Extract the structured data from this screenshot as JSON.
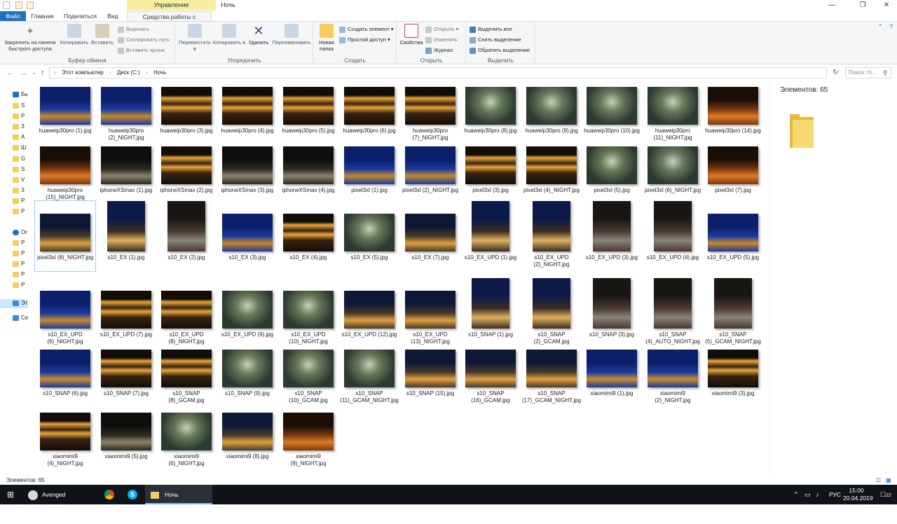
{
  "window": {
    "title": "Ночь",
    "context_tab": "Управление",
    "controls": {
      "minimize": "—",
      "maximize": "❐",
      "close": "✕"
    }
  },
  "tabs": [
    "Файл",
    "Главная",
    "Поделиться",
    "Вид",
    "Средства работы с рисунками"
  ],
  "ribbon": {
    "clipboard": {
      "label": "Буфер обмена",
      "pin": "Закрепить на панели быстрого доступа",
      "copy": "Копировать",
      "paste": "Вставить",
      "cut": "Вырезать",
      "copy_path": "Скопировать путь",
      "paste_shortcut": "Вставить ярлык"
    },
    "organize": {
      "label": "Упорядочить",
      "move": "Переместить в",
      "copyto": "Копировать в",
      "delete": "Удалить",
      "rename": "Переименовать"
    },
    "create": {
      "label": "Создать",
      "new_folder": "Новая папка",
      "new_item": "Создать элемент",
      "easy_access": "Простой доступ"
    },
    "open": {
      "label": "Открыть",
      "properties": "Свойства",
      "open": "Открыть",
      "edit": "Изменить",
      "history": "Журнал"
    },
    "select": {
      "label": "Выделить",
      "select_all": "Выделить все",
      "select_none": "Снять выделение",
      "invert": "Обратить выделение"
    }
  },
  "address": {
    "crumbs": [
      "Этот компьютер",
      "Диск (C:)",
      "Ночь"
    ],
    "search_placeholder": "Поиск: Н..."
  },
  "nav_pane": [
    "Бы",
    "S",
    "Р",
    "З",
    "А",
    "Ш",
    "G",
    "S",
    "V",
    "З",
    "Р",
    "Р",
    "Or",
    "Р",
    "Р",
    "Р",
    "Р",
    "Р",
    "Эт",
    "Се"
  ],
  "files": [
    {
      "name": "huaweip30pro (1).jpg",
      "kind": "blue"
    },
    {
      "name": "huaweip30pro (2)_NIGHT.jpg",
      "kind": "blue"
    },
    {
      "name": "huaweip30pro (3).jpg",
      "kind": "bldg"
    },
    {
      "name": "huaweip30pro (4).jpg",
      "kind": "bldg"
    },
    {
      "name": "huaweip30pro (5).jpg",
      "kind": "bldg"
    },
    {
      "name": "huaweip30pro (6).jpg",
      "kind": "bldg"
    },
    {
      "name": "huaweip30pro (7)_NIGHT.jpg",
      "kind": "bldg"
    },
    {
      "name": "huaweip30pro (8).jpg",
      "kind": "tunnel"
    },
    {
      "name": "huaweip30pro (9).jpg",
      "kind": "tunnel"
    },
    {
      "name": "huaweip30pro (10).jpg",
      "kind": "tunnel"
    },
    {
      "name": "huaweip30pro (11)_NIGHT.jpg",
      "kind": "tunnel"
    },
    {
      "name": "huaweip30pro (14).jpg",
      "kind": "warm"
    },
    {
      "name": "huaweip30pro (15)_NIGHT.jpg",
      "kind": "warm"
    },
    {
      "name": "iphoneXSmax (1).jpg",
      "kind": "dark"
    },
    {
      "name": "iphoneXSmax (2).jpg",
      "kind": "bldg"
    },
    {
      "name": "iphoneXSmax (3).jpg",
      "kind": "dark"
    },
    {
      "name": "iphoneXSmax (4).jpg",
      "kind": "dark"
    },
    {
      "name": "pixel3xl (1).jpg",
      "kind": "blue"
    },
    {
      "name": "pixel3xl (2)_NIGHT.jpg",
      "kind": "blue"
    },
    {
      "name": "pixel3xl (3).jpg",
      "kind": "bldg"
    },
    {
      "name": "pixel3xl (4)_NIGHT.jpg",
      "kind": "bldg"
    },
    {
      "name": "pixel3xl (5).jpg",
      "kind": "tunnel"
    },
    {
      "name": "pixel3xl (6)_NIGHT.jpg",
      "kind": "tunnel"
    },
    {
      "name": "pixel3xl (7).jpg",
      "kind": "warm"
    },
    {
      "name": "pixel3xl (8)_NIGHT.jpg",
      "kind": "river",
      "selected": true
    },
    {
      "name": "s10_EX (1).jpg",
      "kind": "yard",
      "portrait": true
    },
    {
      "name": "s10_EX (2).jpg",
      "kind": "wall",
      "portrait": true
    },
    {
      "name": "s10_EX (3).jpg",
      "kind": "blue"
    },
    {
      "name": "s10_EX (4).jpg",
      "kind": "bldg"
    },
    {
      "name": "s10_EX (5).jpg",
      "kind": "tunnel"
    },
    {
      "name": "s10_EX (7).jpg",
      "kind": "river"
    },
    {
      "name": "s10_EX_UPD (1).jpg",
      "kind": "yard",
      "portrait": true
    },
    {
      "name": "s10_EX_UPD (2)_NIGHT.jpg",
      "kind": "yard",
      "portrait": true
    },
    {
      "name": "s10_EX_UPD (3).jpg",
      "kind": "wall",
      "portrait": true
    },
    {
      "name": "s10_EX_UPD (4).jpg",
      "kind": "wall",
      "portrait": true
    },
    {
      "name": "s10_EX_UPD (5).jpg",
      "kind": "blue"
    },
    {
      "name": "s10_EX_UPD (6)_NIGHT.jpg",
      "kind": "blue"
    },
    {
      "name": "s10_EX_UPD (7).jpg",
      "kind": "bldg"
    },
    {
      "name": "s10_EX_UPD (8)_NIGHT.jpg",
      "kind": "bldg"
    },
    {
      "name": "s10_EX_UPD (9).jpg",
      "kind": "tunnel"
    },
    {
      "name": "s10_EX_UPD (10)_NIGHT.jpg",
      "kind": "tunnel"
    },
    {
      "name": "s10_EX_UPD (12).jpg",
      "kind": "river"
    },
    {
      "name": "s10_EX_UPD (13)_NIGHT.jpg",
      "kind": "river"
    },
    {
      "name": "s10_SNAP (1).jpg",
      "kind": "yard",
      "portrait": true
    },
    {
      "name": "s10_SNAP (2)_GCAM.jpg",
      "kind": "yard",
      "portrait": true
    },
    {
      "name": "s10_SNAP (3).jpg",
      "kind": "wall",
      "portrait": true
    },
    {
      "name": "s10_SNAP (4)_AUTO_NIGHT.jpg",
      "kind": "wall",
      "portrait": true
    },
    {
      "name": "s10_SNAP (5)_GCAM_NIGHT.jpg",
      "kind": "wall",
      "portrait": true
    },
    {
      "name": "s10_SNAP (6).jpg",
      "kind": "blue"
    },
    {
      "name": "s10_SNAP (7).jpg",
      "kind": "bldg"
    },
    {
      "name": "s10_SNAP (8)_GCAM.jpg",
      "kind": "bldg"
    },
    {
      "name": "s10_SNAP (9).jpg",
      "kind": "tunnel"
    },
    {
      "name": "s10_SNAP (10)_GCAM.jpg",
      "kind": "tunnel"
    },
    {
      "name": "s10_SNAP (11)_GCAM_NIGHT.jpg",
      "kind": "tunnel"
    },
    {
      "name": "s10_SNAP (15).jpg",
      "kind": "river"
    },
    {
      "name": "s10_SNAP (16)_GCAM.jpg",
      "kind": "river"
    },
    {
      "name": "s10_SNAP (17)_GCAM_NIGHT.jpg",
      "kind": "river"
    },
    {
      "name": "xiaomimi9 (1).jpg",
      "kind": "blue"
    },
    {
      "name": "xiaomimi9 (2)_NIGHT.jpg",
      "kind": "blue"
    },
    {
      "name": "xiaomimi9 (3).jpg",
      "kind": "bldg"
    },
    {
      "name": "xiaomimi9 (4)_NIGHT.jpg",
      "kind": "bldg"
    },
    {
      "name": "xiaomimi9 (5).jpg",
      "kind": "dark"
    },
    {
      "name": "xiaomimi9 (6)_NIGHT.jpg",
      "kind": "tunnel"
    },
    {
      "name": "xiaomimi9 (8).jpg",
      "kind": "river"
    },
    {
      "name": "xiaomimi9 (9)_NIGHT.jpg",
      "kind": "warm"
    }
  ],
  "preview": {
    "count_text": "Элементов: 65"
  },
  "status": {
    "count_text": "Элементов: 65"
  },
  "taskbar": {
    "app1": "Avenged Sevenfold...",
    "app_explorer": "Ночь",
    "lang": "РУС",
    "time": "15:00",
    "date": "20.04.2019",
    "notif_count": "22"
  },
  "thumb_palettes": {
    "blue": [
      "#0b1f6b",
      "#1b3aa0",
      "#c78a2a"
    ],
    "bldg": [
      "#120d08",
      "#3a2410",
      "#e9a43a"
    ],
    "tunnel": [
      "#2b3a2f",
      "#6a7a5c",
      "#c8d0b8"
    ],
    "warm": [
      "#1a0e05",
      "#7a3a12",
      "#e07a24"
    ],
    "dark": [
      "#0e0e0c",
      "#2c2a22",
      "#8c8468"
    ],
    "river": [
      "#0c1836",
      "#4a3a2a",
      "#e0a040"
    ],
    "yard": [
      "#0c1a4a",
      "#3a2c22",
      "#e0b060"
    ],
    "wall": [
      "#1a1614",
      "#4a3a32",
      "#8a8478"
    ]
  }
}
